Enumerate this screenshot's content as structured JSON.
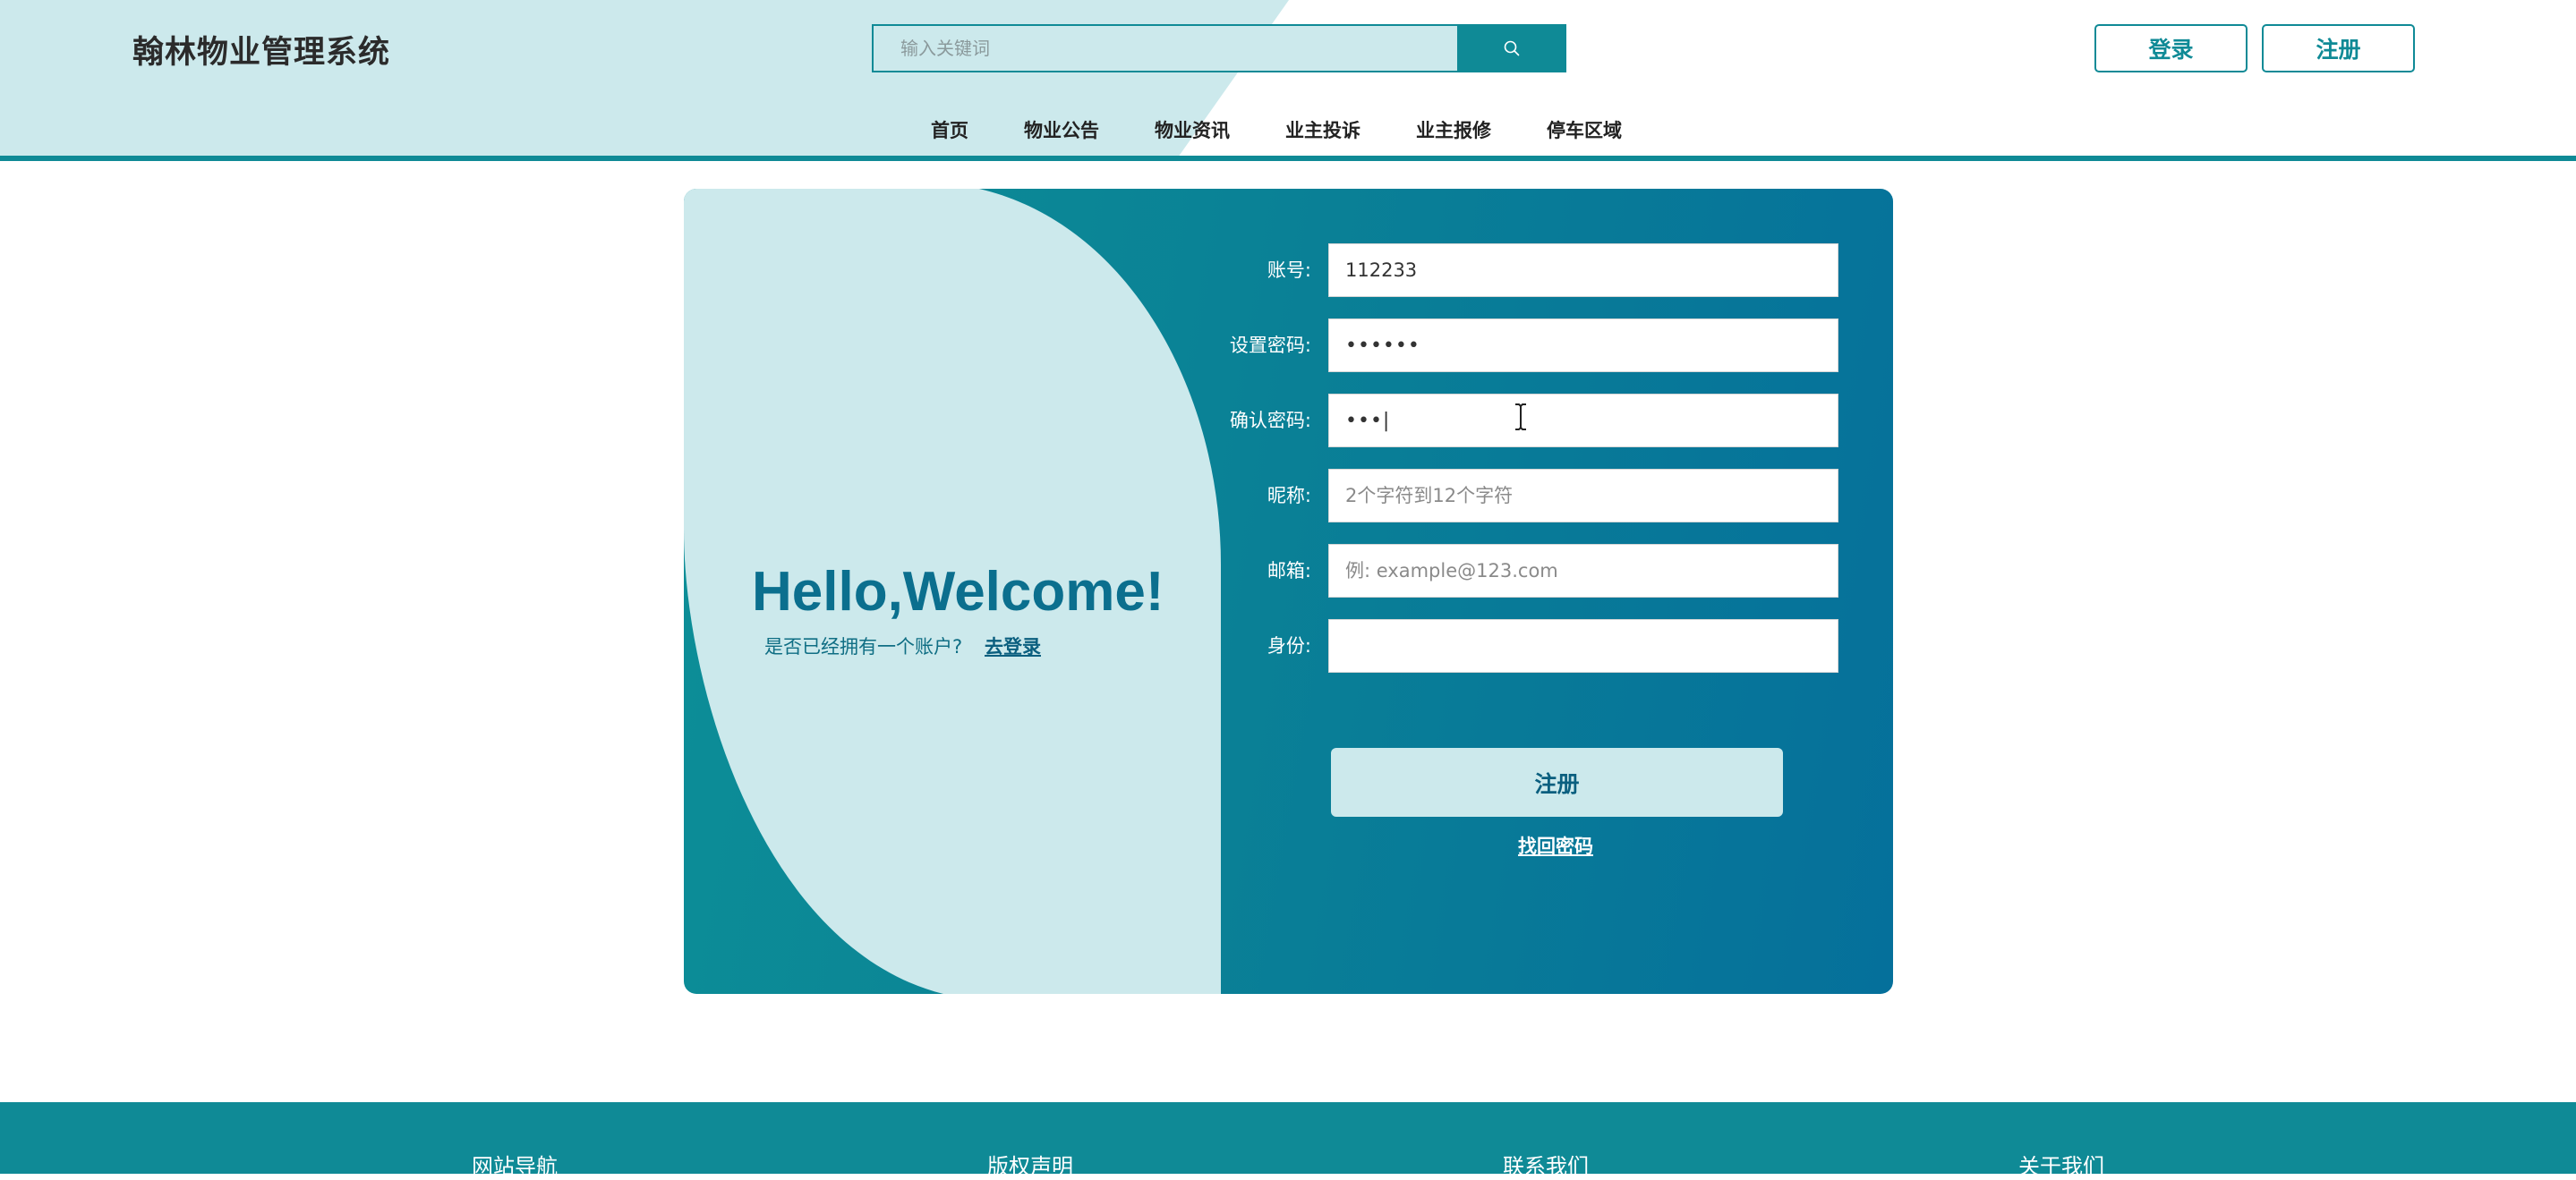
{
  "header": {
    "site_title": "翰林物业管理系统",
    "search_placeholder": "输入关键词",
    "login_label": "登录",
    "register_label": "注册"
  },
  "nav": {
    "items": [
      {
        "label": "首页"
      },
      {
        "label": "物业公告"
      },
      {
        "label": "物业资讯"
      },
      {
        "label": "业主投诉"
      },
      {
        "label": "业主报修"
      },
      {
        "label": "停车区域"
      }
    ]
  },
  "welcome": {
    "title": "Hello,Welcome!",
    "subtitle": "是否已经拥有一个账户?",
    "login_link": "去登录"
  },
  "form": {
    "account": {
      "label": "账号:",
      "value": "112233",
      "placeholder": ""
    },
    "password": {
      "label": "设置密码:",
      "value": "••••••"
    },
    "confirm": {
      "label": "确认密码:",
      "value": "•••|"
    },
    "nickname": {
      "label": "昵称:",
      "value": "",
      "placeholder": "2个字符到12个字符"
    },
    "email": {
      "label": "邮箱:",
      "value": "",
      "placeholder": "例: example@123.com"
    },
    "identity": {
      "label": "身份:",
      "value": ""
    },
    "submit_label": "注册",
    "forgot_label": "找回密码"
  },
  "footer": {
    "items": [
      {
        "label": "网站导航"
      },
      {
        "label": "版权声明"
      },
      {
        "label": "联系我们"
      },
      {
        "label": "关于我们"
      }
    ]
  },
  "colors": {
    "primary": "#0f8a96",
    "light": "#cce9ec",
    "dark_blue": "#05709b"
  },
  "icons": {
    "search": "search-icon",
    "cursor": "text-cursor-icon"
  }
}
